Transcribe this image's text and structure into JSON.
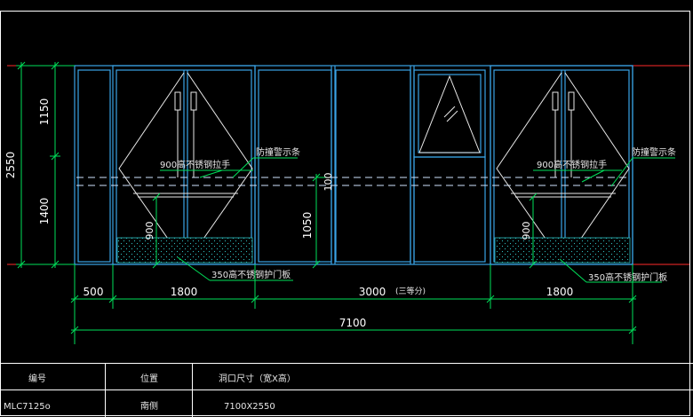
{
  "drawing": {
    "dimensions": {
      "total_height": "2550",
      "upper_height": "1150",
      "lower_height": "1400",
      "transom_height": "100",
      "mid_height": "1050",
      "kick_height_left": "900",
      "kick_height_right": "900",
      "width_500": "500",
      "width_1800_left": "1800",
      "width_3000": "3000",
      "width_3000_note": "(三等分)",
      "width_1800_right": "1800",
      "total_width": "7100"
    },
    "annotations": {
      "handle_left": "900高不锈钢拉手",
      "handle_right": "900高不锈钢拉手",
      "warning_strip_left": "防撞警示条",
      "warning_strip_right": "防撞警示条",
      "kickplate_left": "350高不锈钢护门板",
      "kickplate_right": "350高不锈钢护门板"
    },
    "colors": {
      "background": "#000000",
      "frame": "#3aa3e6",
      "glass_lines": "#e8e8e8",
      "dimension": "#00e05a",
      "level_line": "#ff2a2a",
      "hatch": "#2fbfc0",
      "text": "#ffffff"
    }
  },
  "schedule": {
    "headers": [
      "编号",
      "位置",
      "洞口尺寸（宽X高）"
    ],
    "row": [
      "MLC7125o",
      "南侧",
      "7100X2550"
    ]
  }
}
